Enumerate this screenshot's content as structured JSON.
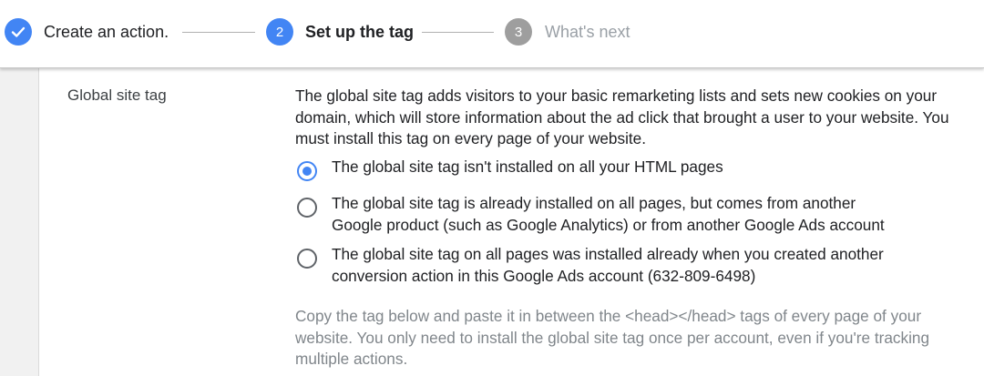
{
  "stepper": {
    "steps": [
      {
        "number": "",
        "label": "Create an action.",
        "state": "done"
      },
      {
        "number": "2",
        "label": "Set up the tag",
        "state": "active"
      },
      {
        "number": "3",
        "label": "What's next",
        "state": "upcoming"
      }
    ]
  },
  "colors": {
    "accent": "#4285f4",
    "upcoming_step": "#9e9e9e",
    "upcoming_text": "#9aa0a6",
    "hint_text": "#80868b"
  },
  "section": {
    "label": "Global site tag",
    "description": "The global site tag adds visitors to your basic remarketing lists and sets new cookies on your domain, which will store information about the ad click that brought a user to your website. You must install this tag on every page of your website.",
    "options": [
      {
        "line1": "The global site tag isn't installed on all your HTML pages",
        "line2": "",
        "selected": true
      },
      {
        "line1": "The global site tag is already installed on all pages, but comes from another",
        "line2": "Google product (such as Google Analytics) or from another Google Ads account",
        "selected": false
      },
      {
        "line1": "The global site tag on all pages was installed already when you created another",
        "line2": "conversion action in this Google Ads account (632-809-6498)",
        "selected": false
      }
    ],
    "hint": "Copy the tag below and paste it in between the <head></head> tags of every page of your website. You only need to install the global site tag once per account, even if you're tracking multiple actions."
  }
}
